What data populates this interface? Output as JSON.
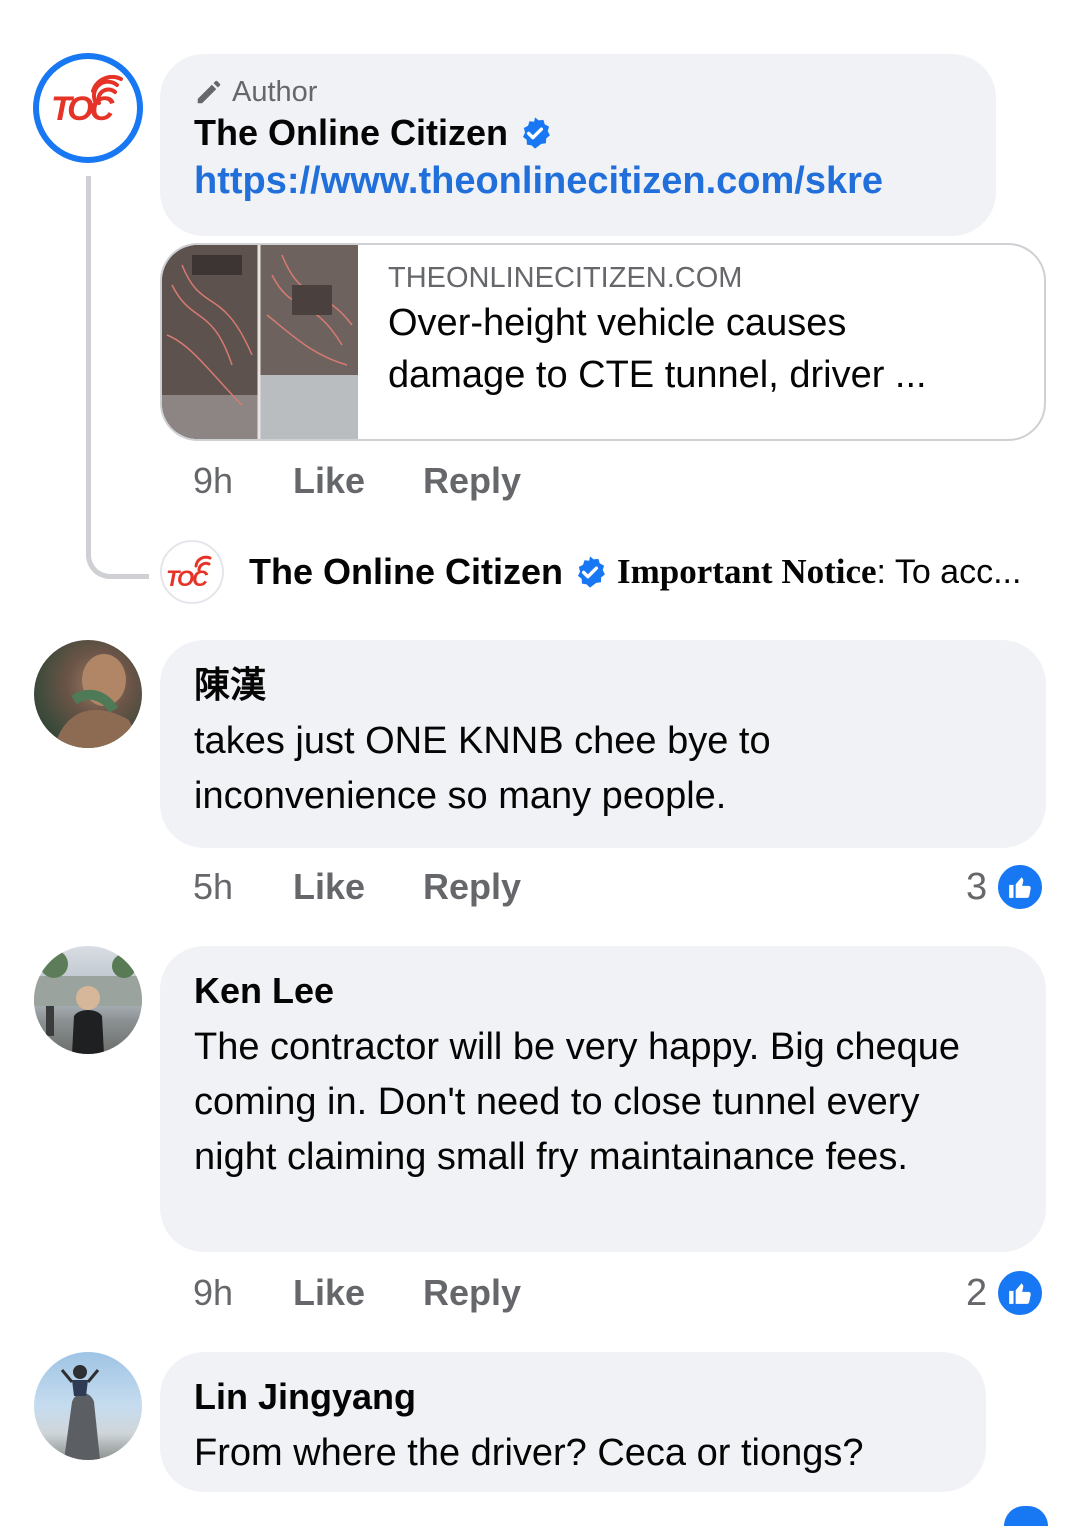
{
  "comments": [
    {
      "author_tag": "Author",
      "name": "The Online Citizen",
      "verified": true,
      "link": "https://www.theonlinecitizen.com/skre",
      "preview": {
        "domain": "THEONLINECITIZEN.COM",
        "title_line1": "Over-height vehicle causes",
        "title_line2": "damage to CTE tunnel, driver ..."
      },
      "time": "9h",
      "like": "Like",
      "reply": "Reply",
      "reply_preview": {
        "name": "The Online Citizen",
        "notice_bold": "Important Notice",
        "notice_rest": ": To acc..."
      },
      "logo_text": "TOC"
    },
    {
      "name": "陳漢",
      "text": "takes just ONE KNNB chee bye to inconvenience so many people.",
      "time": "5h",
      "like": "Like",
      "reply": "Reply",
      "reactions": "3"
    },
    {
      "name": "Ken Lee",
      "text": "The contractor will be very happy. Big cheque coming in. Don't need to close tunnel every night claiming small fry maintainance fees.",
      "time": "9h",
      "like": "Like",
      "reply": "Reply",
      "reactions": "2"
    },
    {
      "name": "Lin Jingyang",
      "text": "From where the driver? Ceca or tiongs?"
    }
  ],
  "colors": {
    "accent": "#1877f2",
    "link": "#216fdb",
    "bubble": "#f0f2f5",
    "meta": "#65676b",
    "toc_red": "#e63328"
  },
  "icons": [
    "pencil-icon",
    "verified-badge-icon",
    "like-thumb-icon",
    "toc-logo"
  ]
}
